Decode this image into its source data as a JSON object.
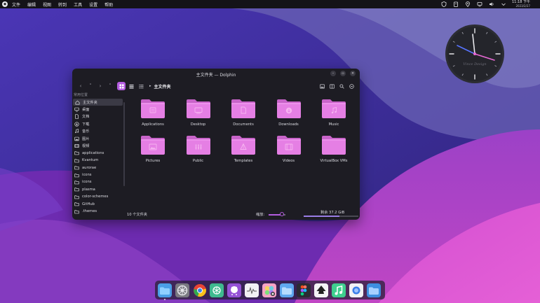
{
  "menubar": {
    "items": [
      "文件",
      "编辑",
      "视图",
      "转到",
      "工具",
      "设置",
      "帮助"
    ],
    "clock_time": "11:18 下午",
    "clock_date": "2023/2/27"
  },
  "clock_widget": {
    "brand": "Vince Design"
  },
  "window": {
    "title": "主文件夹 — Dolphin",
    "breadcrumb": "主文件夹",
    "sidebar_heading": "常用位置",
    "sidebar_items": [
      {
        "label": "主文件夹",
        "icon": "home-icon",
        "selected": true
      },
      {
        "label": "桌面",
        "icon": "desktop-icon"
      },
      {
        "label": "文档",
        "icon": "document-icon"
      },
      {
        "label": "下载",
        "icon": "download-icon"
      },
      {
        "label": "音乐",
        "icon": "music-icon"
      },
      {
        "label": "图片",
        "icon": "picture-icon"
      },
      {
        "label": "视频",
        "icon": "video-icon"
      },
      {
        "label": "applications",
        "icon": "folder-icon"
      },
      {
        "label": "Kvantum",
        "icon": "folder-icon"
      },
      {
        "label": "aurorae",
        "icon": "folder-icon"
      },
      {
        "label": "icons",
        "icon": "folder-icon"
      },
      {
        "label": "icons",
        "icon": "folder-icon"
      },
      {
        "label": "plasma",
        "icon": "folder-icon"
      },
      {
        "label": "color-schemes",
        "icon": "folder-icon"
      },
      {
        "label": "GitHub",
        "icon": "folder-icon"
      },
      {
        "label": ".themes",
        "icon": "folder-icon"
      }
    ],
    "folders": [
      {
        "label": "Applications",
        "icon": "applications-folder-icon"
      },
      {
        "label": "Desktop",
        "icon": "desktop-folder-icon"
      },
      {
        "label": "Documents",
        "icon": "documents-folder-icon"
      },
      {
        "label": "Downloads",
        "icon": "downloads-folder-icon"
      },
      {
        "label": "Music",
        "icon": "music-folder-icon"
      },
      {
        "label": "Pictures",
        "icon": "pictures-folder-icon"
      },
      {
        "label": "Public",
        "icon": "public-folder-icon"
      },
      {
        "label": "Templates",
        "icon": "templates-folder-icon"
      },
      {
        "label": "Videos",
        "icon": "videos-folder-icon"
      },
      {
        "label": "VirtualBox VMs",
        "icon": "virtualbox-folder-icon"
      }
    ],
    "status": {
      "count": "10 个文件夹",
      "zoom_label": "缩放:",
      "zoom_level": 0.8,
      "free_space": "剩余 37.2 GiB",
      "free_fraction": 0.65
    }
  },
  "dock": {
    "apps": [
      "finder-icon",
      "settings-icon",
      "chrome-icon",
      "chatgpt-icon",
      "github-icon",
      "activity-monitor-icon",
      "photos-icon",
      "files-icon",
      "figma-icon",
      "inkscape-icon",
      "music-player-icon",
      "browser-icon",
      "folder-icon"
    ]
  },
  "colors": {
    "accent": "#b45ce0",
    "folder": "#e57fe4",
    "window_bg": "#1d1c23"
  }
}
